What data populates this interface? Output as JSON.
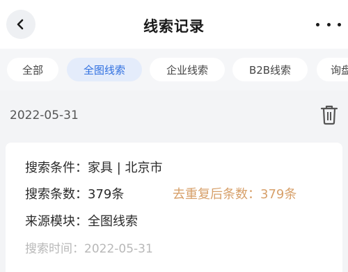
{
  "header": {
    "title": "线索记录"
  },
  "tabs": [
    {
      "label": "全部",
      "active": false
    },
    {
      "label": "全图线索",
      "active": true
    },
    {
      "label": "企业线索",
      "active": false
    },
    {
      "label": "B2B线索",
      "active": false
    },
    {
      "label": "询盘",
      "active": false
    }
  ],
  "record": {
    "date": "2022-05-31",
    "search_condition_label": "搜索条件：",
    "search_condition_value": "家具 | 北京市",
    "search_count_label": "搜索条数：",
    "search_count_value": "379条",
    "dedup_label": "去重复后条数：",
    "dedup_value": "379条",
    "source_label": "来源模块：",
    "source_value": "全图线索",
    "search_time_label": "搜索时间：",
    "search_time_value": "2022-05-31"
  },
  "icons": {
    "back": "chevron-left-icon",
    "more": "more-dots-icon",
    "delete": "trash-icon"
  },
  "colors": {
    "accent": "#2f6fe0",
    "active_tab_bg": "#e4ecfb",
    "dedup_text": "#d7a06a",
    "muted_text": "#b8b8b8"
  }
}
